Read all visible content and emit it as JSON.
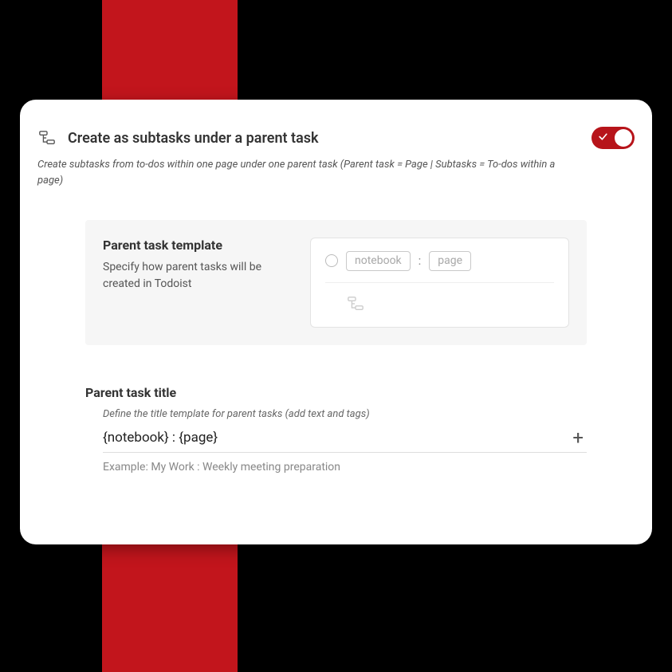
{
  "header": {
    "title": "Create as subtasks under a parent task",
    "description": "Create subtasks from to-dos within one page under one parent task (Parent task = Page | Subtasks = To-dos within a page)",
    "toggle_on": true
  },
  "template": {
    "heading": "Parent task template",
    "subtext": "Specify how parent tasks will be created in Todoist",
    "chips": {
      "notebook": "notebook",
      "separator": ":",
      "page": "page"
    }
  },
  "title_section": {
    "heading": "Parent task title",
    "hint": "Define the title template for parent tasks (add text and tags)",
    "value": "{notebook} : {page}",
    "example": "Example: My Work : Weekly meeting preparation"
  }
}
